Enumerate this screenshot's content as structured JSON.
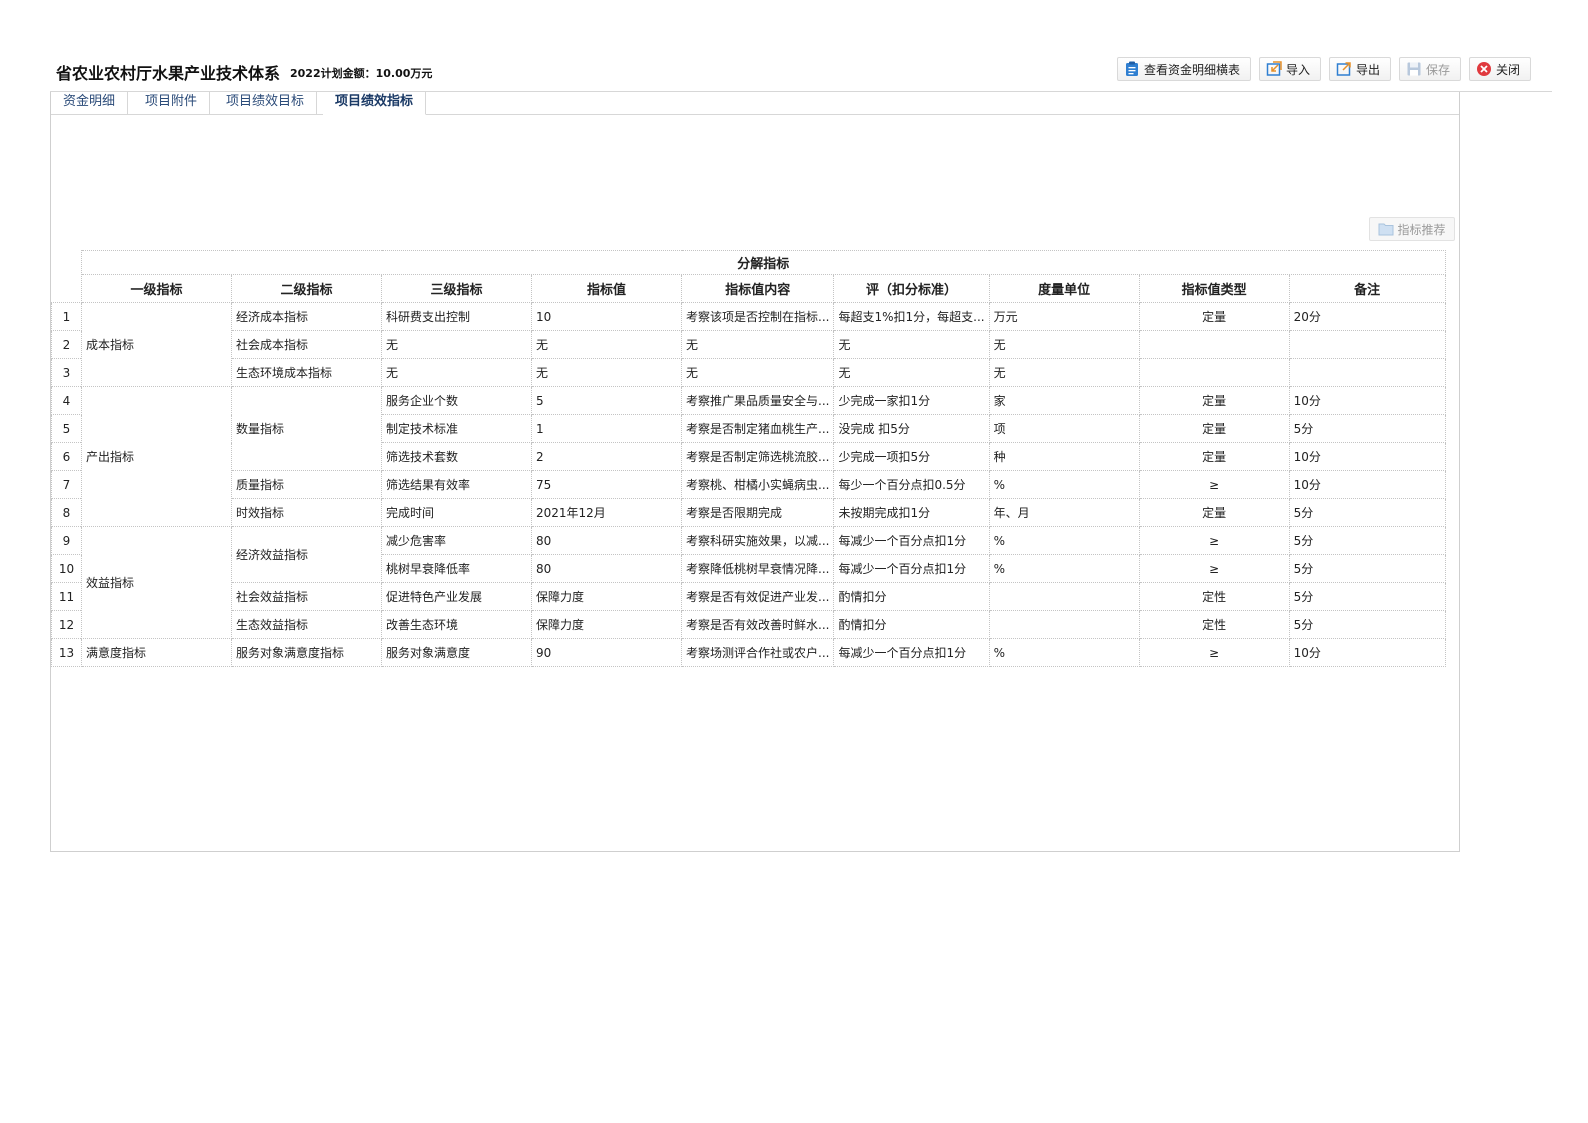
{
  "header": {
    "title": "省农业农村厅水果产业技术体系",
    "amount": "2022计划金额：10.00万元"
  },
  "toolbar": {
    "view_fund_detail": "查看资金明细横表",
    "import": "导入",
    "export": "导出",
    "save": "保存",
    "close": "关闭",
    "icon_color": "#2f7fd1",
    "close_icon_color": "#e0393e"
  },
  "tabs": [
    "资金明细",
    "项目附件",
    "项目绩效目标",
    "项目绩效指标"
  ],
  "active_tab": "项目绩效指标",
  "recommend_button": "指标推荐",
  "table": {
    "group_header": "分解指标",
    "columns": [
      "一级指标",
      "二级指标",
      "三级指标",
      "指标值",
      "指标值内容",
      "评（扣分标准）",
      "度量单位",
      "指标值类型",
      "备注"
    ],
    "level1": [
      {
        "label": "成本指标",
        "start": 1,
        "span": 3
      },
      {
        "label": "产出指标",
        "start": 4,
        "span": 5
      },
      {
        "label": "效益指标",
        "start": 9,
        "span": 4
      },
      {
        "label": "满意度指标",
        "start": 13,
        "span": 1
      }
    ],
    "level2": [
      {
        "label": "经济成本指标",
        "start": 1,
        "span": 1
      },
      {
        "label": "社会成本指标",
        "start": 2,
        "span": 1
      },
      {
        "label": "生态环境成本指标",
        "start": 3,
        "span": 1
      },
      {
        "label": "数量指标",
        "start": 4,
        "span": 3
      },
      {
        "label": "质量指标",
        "start": 7,
        "span": 1
      },
      {
        "label": "时效指标",
        "start": 8,
        "span": 1
      },
      {
        "label": "经济效益指标",
        "start": 9,
        "span": 2
      },
      {
        "label": "社会效益指标",
        "start": 11,
        "span": 1
      },
      {
        "label": "生态效益指标",
        "start": 12,
        "span": 1
      },
      {
        "label": "服务对象满意度指标",
        "start": 13,
        "span": 1
      }
    ],
    "rows": [
      {
        "no": "1",
        "level3": "科研费支出控制",
        "value": "10",
        "content": "考察该项是否控制在指标...",
        "scoring": "每超支1%扣1分，每超支...",
        "unit": "万元",
        "type": "定量",
        "note": "20分"
      },
      {
        "no": "2",
        "level3": "无",
        "value": "无",
        "content": "无",
        "scoring": "无",
        "unit": "无",
        "type": "",
        "note": ""
      },
      {
        "no": "3",
        "level3": "无",
        "value": "无",
        "content": "无",
        "scoring": "无",
        "unit": "无",
        "type": "",
        "note": ""
      },
      {
        "no": "4",
        "level3": "服务企业个数",
        "value": "5",
        "content": "考察推广果品质量安全与...",
        "scoring": "少完成一家扣1分",
        "unit": "家",
        "type": "定量",
        "note": "10分"
      },
      {
        "no": "5",
        "level3": "制定技术标准",
        "value": "1",
        "content": "考察是否制定猪血桃生产...",
        "scoring": "没完成 扣5分",
        "unit": "项",
        "type": "定量",
        "note": "5分"
      },
      {
        "no": "6",
        "level3": "筛选技术套数",
        "value": "2",
        "content": "考察是否制定筛选桃流胶...",
        "scoring": "少完成一项扣5分",
        "unit": "种",
        "type": "定量",
        "note": "10分"
      },
      {
        "no": "7",
        "level3": "筛选结果有效率",
        "value": "75",
        "content": "考察桃、柑橘小实蝇病虫...",
        "scoring": "每少一个百分点扣0.5分",
        "unit": "%",
        "type": "≥",
        "note": "10分"
      },
      {
        "no": "8",
        "level3": "完成时间",
        "value": "2021年12月",
        "content": "考察是否限期完成",
        "scoring": "未按期完成扣1分",
        "unit": "年、月",
        "type": "定量",
        "note": "5分"
      },
      {
        "no": "9",
        "level3": "减少危害率",
        "value": "80",
        "content": "考察科研实施效果，以减...",
        "scoring": "每减少一个百分点扣1分",
        "unit": "%",
        "type": "≥",
        "note": "5分"
      },
      {
        "no": "10",
        "level3": "桃树早衰降低率",
        "value": "80",
        "content": "考察降低桃树早衰情况降...",
        "scoring": "每减少一个百分点扣1分",
        "unit": "%",
        "type": "≥",
        "note": "5分"
      },
      {
        "no": "11",
        "level3": "促进特色产业发展",
        "value": "保障力度",
        "content": "考察是否有效促进产业发...",
        "scoring": "酌情扣分",
        "unit": "",
        "type": "定性",
        "note": "5分"
      },
      {
        "no": "12",
        "level3": "改善生态环境",
        "value": "保障力度",
        "content": "考察是否有效改善时鲜水...",
        "scoring": "酌情扣分",
        "unit": "",
        "type": "定性",
        "note": "5分"
      },
      {
        "no": "13",
        "level3": "服务对象满意度",
        "value": "90",
        "content": "考察场测评合作社或农户...",
        "scoring": "每减少一个百分点扣1分",
        "unit": "%",
        "type": "≥",
        "note": "10分"
      }
    ]
  }
}
